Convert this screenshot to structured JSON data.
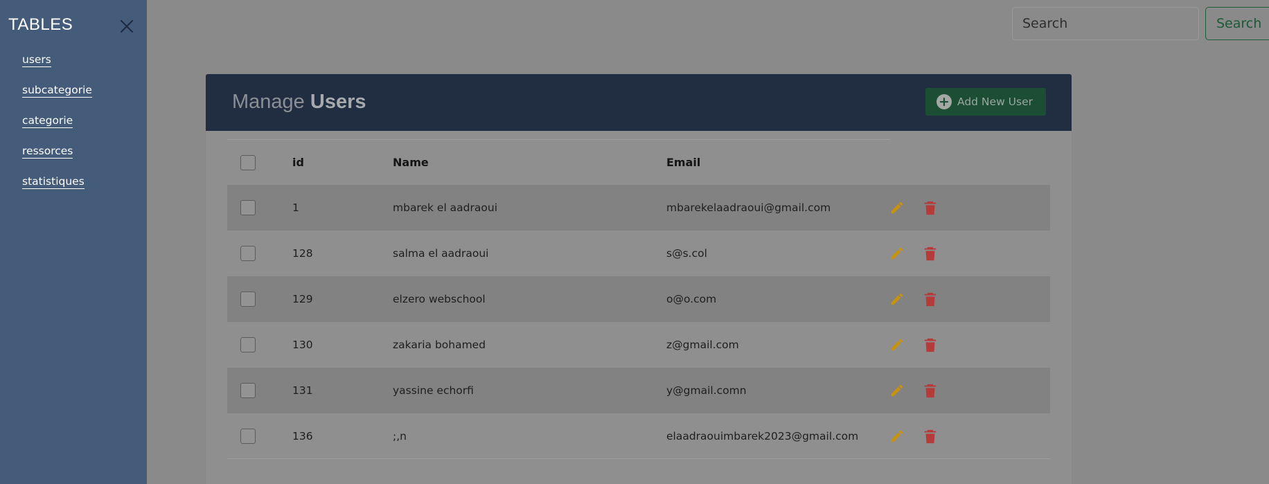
{
  "sidebar": {
    "title": "TABLES",
    "close_icon": "close-icon",
    "items": [
      {
        "label": "users"
      },
      {
        "label": "subcategorie"
      },
      {
        "label": "categorie"
      },
      {
        "label": "ressorces"
      },
      {
        "label": "statistiques"
      }
    ]
  },
  "search": {
    "placeholder": "Search",
    "button_label": "Search"
  },
  "card": {
    "title_prefix": "Manage",
    "title_bold": "Users",
    "add_button_label": "Add New User",
    "add_icon": "plus-circle-icon"
  },
  "table": {
    "columns": [
      "id",
      "Name",
      "Email"
    ],
    "rows": [
      {
        "id": "1",
        "name": "mbarek el aadraoui",
        "email": "mbarekelaadraoui@gmail.com"
      },
      {
        "id": "128",
        "name": "salma el aadraoui",
        "email": "s@s.col"
      },
      {
        "id": "129",
        "name": "elzero webschool",
        "email": "o@o.com"
      },
      {
        "id": "130",
        "name": "zakaria bohamed",
        "email": "z@gmail.com"
      },
      {
        "id": "131",
        "name": "yassine echorfi",
        "email": "y@gmail.comn"
      },
      {
        "id": "136",
        "name": ";,n",
        "email": "elaadraouimbarek2023@gmail.com"
      }
    ],
    "edit_icon": "pencil-icon",
    "delete_icon": "trash-icon"
  },
  "colors": {
    "sidebar_bg": "#445b7a",
    "header_bg": "#212e42",
    "add_button_bg": "#1b4e33",
    "edit_icon": "#c8920e",
    "delete_icon": "#b53a3a",
    "overlay_bg": "#8a8a8a"
  }
}
